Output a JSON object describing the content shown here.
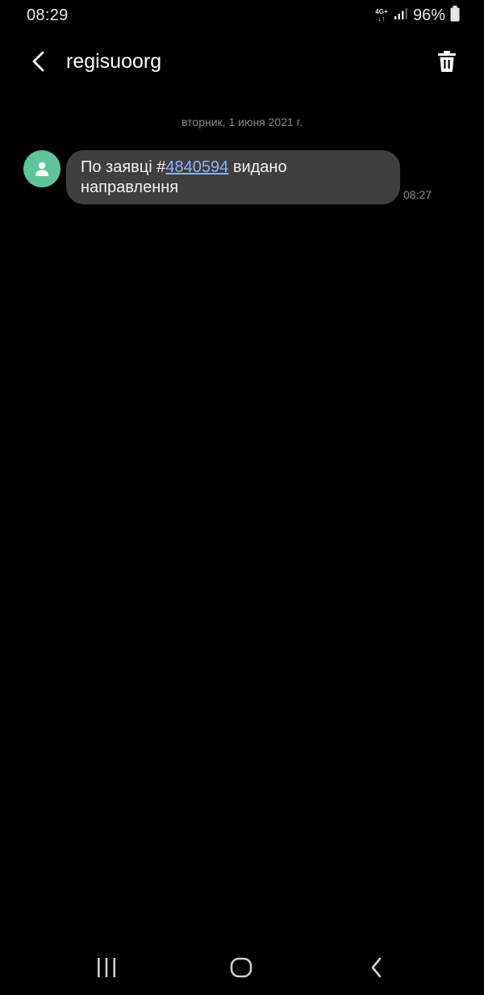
{
  "status_bar": {
    "time": "08:29",
    "network_type": "4G+",
    "network_arrows": "↓↑",
    "battery_percent": "96%",
    "icons": [
      "signal-icon",
      "battery-icon"
    ]
  },
  "header": {
    "title": "regisuoorg",
    "back_icon": "back-arrow-icon",
    "delete_icon": "trash-icon"
  },
  "conversation": {
    "date_divider": "вторник, 1 июня 2021 г.",
    "messages": [
      {
        "text_before": "По заявці #",
        "link": "4840594",
        "text_after": " видано направлення",
        "time": "08:27"
      }
    ]
  },
  "nav_bar": {
    "icons": [
      "recent-apps-icon",
      "home-icon",
      "back-icon"
    ]
  },
  "colors": {
    "background": "#000000",
    "bubble": "#3f3f3f",
    "avatar": "#5fc49a",
    "link": "#8ab4f8",
    "muted_text": "#8a8a8a"
  }
}
